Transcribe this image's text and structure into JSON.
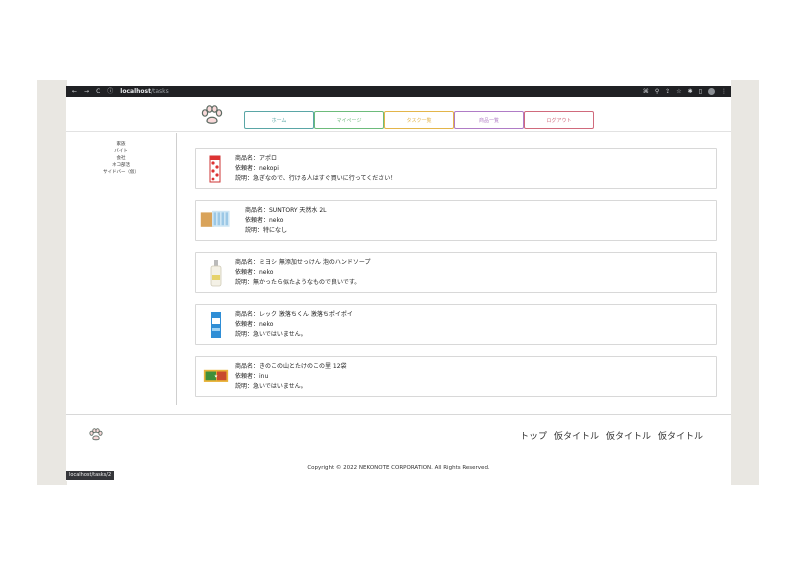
{
  "browser": {
    "url_host": "localhost",
    "url_path": "/tasks",
    "status_url": "localhost/tasks/2"
  },
  "nav": {
    "items": [
      {
        "label": "ホーム",
        "color": "#5aa6a6"
      },
      {
        "label": "マイページ",
        "color": "#6dbb7b"
      },
      {
        "label": "タスク一覧",
        "color": "#e3b54a"
      },
      {
        "label": "商品一覧",
        "color": "#b07cc6"
      },
      {
        "label": "ログアウト",
        "color": "#d06a7c"
      }
    ]
  },
  "sidebar": {
    "items": [
      "家族",
      "バイト",
      "会社",
      "ネコ部活",
      "サイドバー（仮）"
    ]
  },
  "tasks": [
    {
      "product": "商品名：アポロ",
      "requester": "依頼者：nekopi",
      "description": "説明：急ぎなので、行ける人はすぐ買いに行ってください！",
      "icon": "chocolate-box-icon"
    },
    {
      "product": "商品名：SUNTORY 天然水 2L",
      "requester": "依頼者：neko",
      "description": "説明：特になし",
      "icon": "water-bottles-icon"
    },
    {
      "product": "商品名：ミヨシ 無添加せっけん 泡のハンドソープ",
      "requester": "依頼者：neko",
      "description": "説明：無かったら似たようなもので良いです。",
      "icon": "soap-bottle-icon"
    },
    {
      "product": "商品名：レック 激落ちくん 激落ちポイポイ",
      "requester": "依頼者：neko",
      "description": "説明：急いではいません。",
      "icon": "cleaning-wipes-icon"
    },
    {
      "product": "商品名：きのこの山とたけのこの里 12袋",
      "requester": "依頼者：inu",
      "description": "説明：急いではいません。",
      "icon": "snack-box-icon"
    }
  ],
  "footer": {
    "links": [
      "トップ",
      "仮タイトル",
      "仮タイトル",
      "仮タイトル"
    ],
    "copyright": "Copyright © 2022 NEKONOTE CORPORATION. All Rights Reserved."
  }
}
